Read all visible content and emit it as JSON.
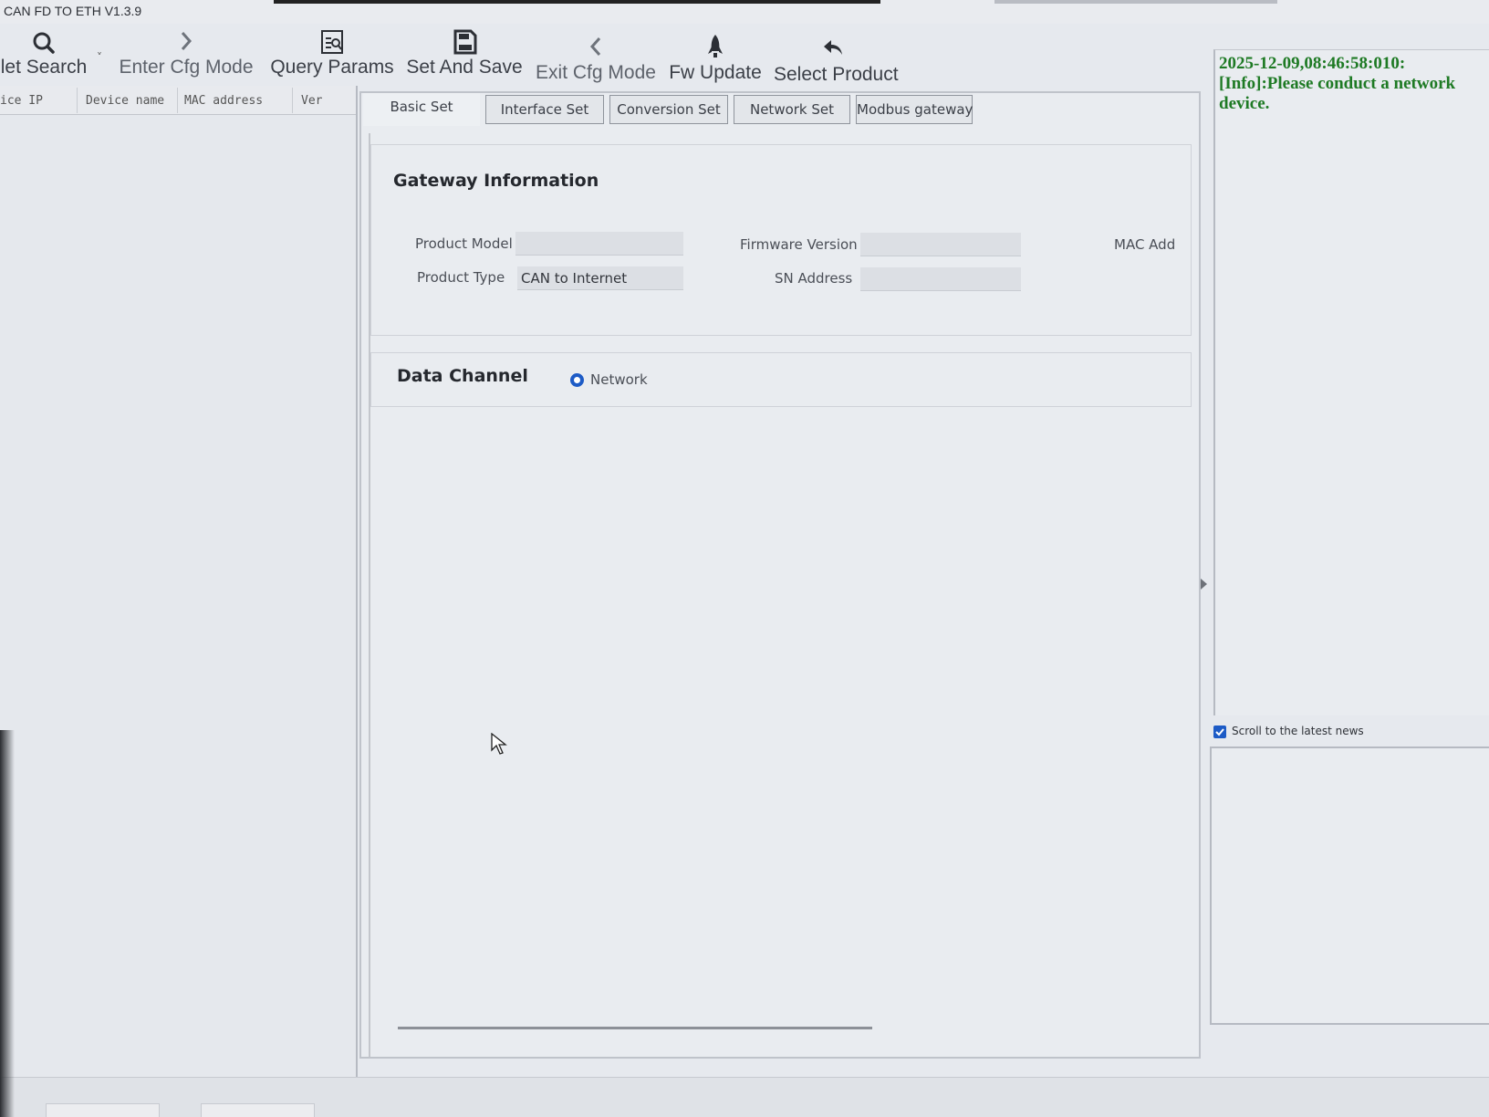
{
  "window": {
    "title": "CAN FD TO ETH V1.3.9"
  },
  "toolbar": {
    "net_search": "let Search",
    "enter_cfg": "Enter Cfg Mode",
    "query_params": "Query Params",
    "set_and_save": "Set And Save",
    "exit_cfg": "Exit Cfg Mode",
    "fw_update": "Fw Update",
    "select_product": "Select Product"
  },
  "device_list": {
    "columns": [
      "ice IP",
      "Device name",
      "MAC address",
      "Ver"
    ]
  },
  "tabs": [
    "Basic Set",
    "Interface Set",
    "Conversion Set",
    "Network Set",
    "Modbus gateway"
  ],
  "active_tab": "Interface Set",
  "gateway_info": {
    "title": "Gateway Information",
    "product_model_label": "Product Model",
    "product_model_value": "",
    "firmware_version_label": "Firmware Version",
    "firmware_version_value": "",
    "mac_label": "MAC Add",
    "product_type_label": "Product Type",
    "product_type_value": "CAN to Internet",
    "sn_address_label": "SN Address",
    "sn_address_value": ""
  },
  "data_channel": {
    "title": "Data Channel",
    "option": "Network",
    "selected": true
  },
  "log": {
    "text": "2025-12-09,08:46:58:010:\n[Info]:Please conduct a network\ndevice.",
    "color": "#1e7a24"
  },
  "scroll_latest": {
    "label": "Scroll to the latest news",
    "checked": true
  },
  "colors": {
    "accent": "#1d5bc6",
    "background": "#e6e9ee"
  }
}
